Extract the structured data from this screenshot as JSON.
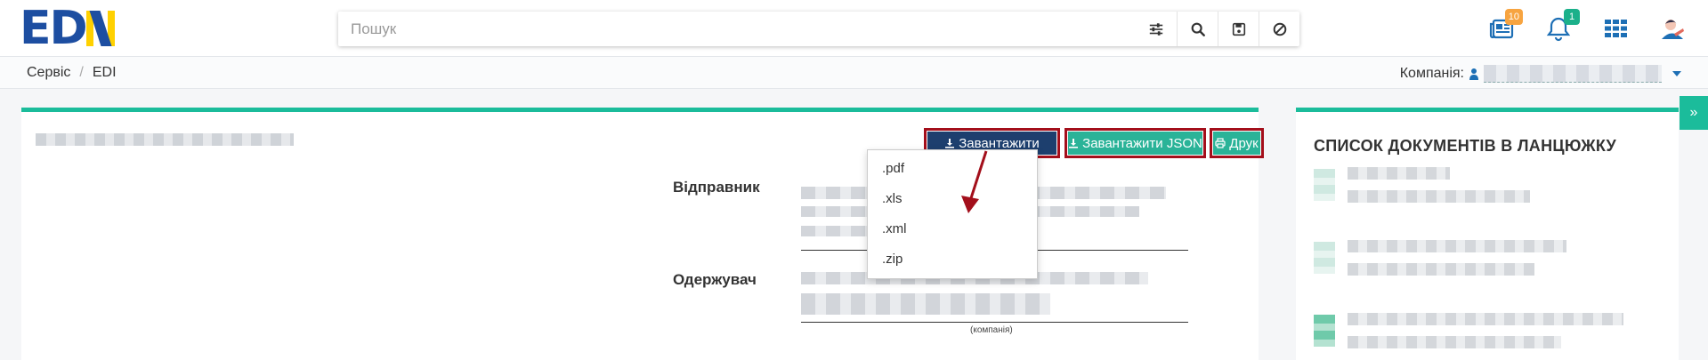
{
  "logo": {
    "part1": "ED",
    "part2": "I",
    "part3": "N"
  },
  "search": {
    "placeholder": "Пошук"
  },
  "header": {
    "icons": [
      {
        "name": "news-icon",
        "badge": "10",
        "badge_color": "#f7a440"
      },
      {
        "name": "bell-icon",
        "badge": "1",
        "badge_color": "#1bb08a"
      },
      {
        "name": "apps-grid-icon"
      },
      {
        "name": "user-avatar-icon"
      }
    ]
  },
  "breadcrumb": {
    "items": [
      "Сервіс",
      "EDI"
    ],
    "separator": "/"
  },
  "company": {
    "label": "Компанія:"
  },
  "toolbar": {
    "download_label": "Завантажити",
    "json_label": "Завантажити JSON",
    "print_label": "Друк"
  },
  "download_menu": {
    "items": [
      ".pdf",
      ".xls",
      ".xml",
      ".zip"
    ]
  },
  "document": {
    "sender_label": "Відправник",
    "receiver_label": "Одержувач",
    "company_caption": "(компанія)"
  },
  "side_panel": {
    "title": "СПИСОК ДОКУМЕНТІВ В ЛАНЦЮЖКУ"
  },
  "colors": {
    "accent": "#1bbc9b",
    "download_button": "#1d3f6e",
    "highlight_outline": "#a30f1b",
    "logo_blue": "#1d4ea1",
    "logo_yellow": "#ffd100"
  }
}
